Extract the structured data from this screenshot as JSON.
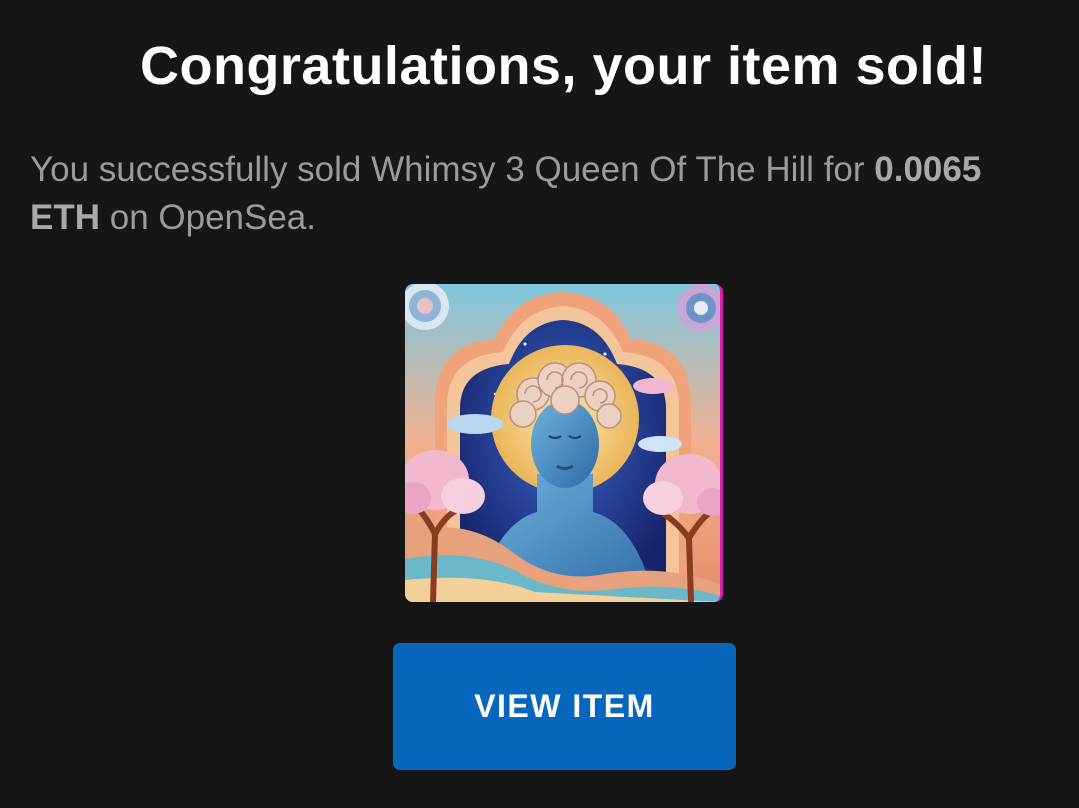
{
  "email": {
    "heading": "Congratulations, your item sold!",
    "message": {
      "prefix": "You successfully sold ",
      "item_name": "Whimsy 3 Queen Of The Hill",
      "for_text": " for ",
      "price": "0.0065 ETH",
      "suffix": " on OpenSea."
    },
    "item_image": {
      "icon": "nft-artwork-image",
      "description_colors": {
        "sky": "#1f3a8a",
        "moon": "#f3d27a",
        "face": "#4a8fc4",
        "hair": "#e9c9b6",
        "trees": "#f2b8cf",
        "frame": "#e8a07a"
      }
    },
    "button": {
      "label": "VIEW ITEM",
      "color": "#0866bd"
    }
  }
}
